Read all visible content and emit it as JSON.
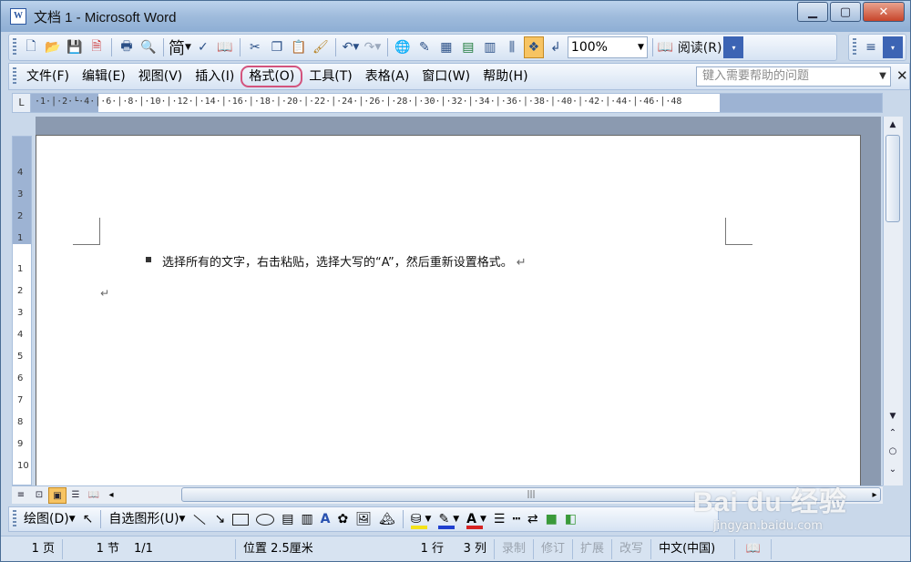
{
  "window": {
    "title": "文档 1 - Microsoft Word",
    "app_icon": "W",
    "controls": [
      "minimize-icon",
      "maximize-icon",
      "close-icon"
    ]
  },
  "standard_toolbar": {
    "buttons": [
      "new-icon",
      "open-icon",
      "save-icon",
      "permission-icon",
      "print-icon",
      "print-preview-icon"
    ],
    "simplified_label": "简",
    "zoom": "100%",
    "read_label": "阅读(R)"
  },
  "menu": {
    "items": [
      {
        "label": "文件(F)"
      },
      {
        "label": "编辑(E)"
      },
      {
        "label": "视图(V)"
      },
      {
        "label": "插入(I)"
      },
      {
        "label": "格式(O)"
      },
      {
        "label": "工具(T)"
      },
      {
        "label": "表格(A)"
      },
      {
        "label": "窗口(W)"
      },
      {
        "label": "帮助(H)"
      }
    ],
    "help_placeholder": "键入需要帮助的问题",
    "close": "✕"
  },
  "ruler": {
    "tab_selector": "L",
    "scale": "·1·│·2·└·4·│·6·│·8·│·10·│·12·│·14·│·16·│·18·│·20·│·22·│·24·│·26·│·28·│·30·│·32·│·34·│·36·│·38·│·40·│·42·│·44·│·46·│·48",
    "vertical_marks": [
      "4",
      "3",
      "2",
      "1",
      "1",
      "2",
      "3",
      "4",
      "5",
      "6",
      "7",
      "8",
      "9",
      "10"
    ]
  },
  "document": {
    "paragraph": "选择所有的文字，右击粘贴，选择大写的“A”，然后重新设置格式。",
    "paragraph_mark": "↵",
    "empty_mark": "↵"
  },
  "scrollbar": {
    "up": "▲",
    "down": "▼",
    "prev_page": "⌃",
    "select_browse": "○",
    "next_page": "⌄",
    "left": "◂",
    "right": "▸",
    "grip": "|||"
  },
  "view_buttons": [
    "normal-view-icon",
    "web-view-icon",
    "print-view-icon",
    "outline-view-icon",
    "reading-view-icon"
  ],
  "drawing_toolbar": {
    "draw_label": "绘图(D)",
    "autoshapes_label": "自选图形(U)",
    "fill_color": "#f4e21a",
    "line_color": "#1f3fcf",
    "font_color": "#d62222"
  },
  "statusbar": {
    "page": "1 页",
    "section": "1 节",
    "page_of": "1/1",
    "position": "位置 2.5厘米",
    "line": "1 行",
    "column": "3 列",
    "rec": "录制",
    "trk": "修订",
    "ext": "扩展",
    "ovr": "改写",
    "language": "中文(中国)"
  },
  "watermark": {
    "logo": "Bai du 经验",
    "url": "jingyan.baidu.com"
  }
}
